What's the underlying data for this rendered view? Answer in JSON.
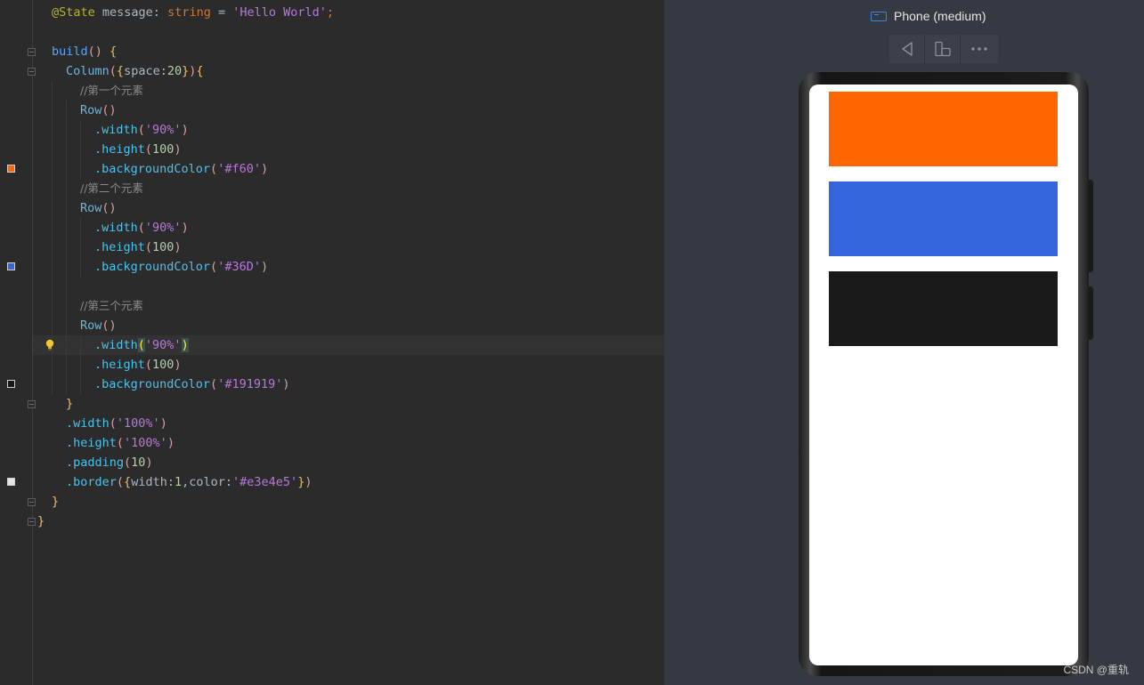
{
  "editor": {
    "lines": [
      [
        [
          "@State",
          "t-anno"
        ],
        [
          " message: ",
          "t-plain"
        ],
        [
          "string",
          "t-kw"
        ],
        [
          " = ",
          "t-plain"
        ],
        [
          "'Hello World'",
          "t-str"
        ],
        [
          ";",
          "t-kw"
        ]
      ],
      [],
      [
        [
          "build",
          "t-fn"
        ],
        [
          "() ",
          "t-paren"
        ],
        [
          "{",
          "t-brace"
        ]
      ],
      [
        [
          "Column",
          "t-comp"
        ],
        [
          "(",
          "t-paren"
        ],
        [
          "{",
          "t-brace"
        ],
        [
          "space",
          "t-prop"
        ],
        [
          ":",
          "t-plain"
        ],
        [
          "20",
          "t-num"
        ],
        [
          "}",
          "t-brace"
        ],
        [
          ")",
          "t-paren"
        ],
        [
          "{",
          "t-brace"
        ]
      ],
      [
        [
          "//第一个元素",
          "t-cmt"
        ]
      ],
      [
        [
          "Row",
          "t-comp"
        ],
        [
          "()",
          "t-paren"
        ]
      ],
      [
        [
          ".width",
          "t-meth"
        ],
        [
          "(",
          "t-paren"
        ],
        [
          "'90%'",
          "t-str"
        ],
        [
          ")",
          "t-paren"
        ]
      ],
      [
        [
          ".height",
          "t-meth"
        ],
        [
          "(",
          "t-paren"
        ],
        [
          "100",
          "t-num"
        ],
        [
          ")",
          "t-paren"
        ]
      ],
      [
        [
          ".backgroundColor",
          "t-meth"
        ],
        [
          "(",
          "t-paren"
        ],
        [
          "'#f60'",
          "t-str"
        ],
        [
          ")",
          "t-paren"
        ]
      ],
      [
        [
          "//第二个元素",
          "t-cmt"
        ]
      ],
      [
        [
          "Row",
          "t-comp"
        ],
        [
          "()",
          "t-paren"
        ]
      ],
      [
        [
          ".width",
          "t-meth"
        ],
        [
          "(",
          "t-paren"
        ],
        [
          "'90%'",
          "t-str"
        ],
        [
          ")",
          "t-paren"
        ]
      ],
      [
        [
          ".height",
          "t-meth"
        ],
        [
          "(",
          "t-paren"
        ],
        [
          "100",
          "t-num"
        ],
        [
          ")",
          "t-paren"
        ]
      ],
      [
        [
          ".backgroundColor",
          "t-meth"
        ],
        [
          "(",
          "t-paren"
        ],
        [
          "'#36D'",
          "t-str"
        ],
        [
          ")",
          "t-paren"
        ]
      ],
      [],
      [
        [
          "//第三个元素",
          "t-cmt"
        ]
      ],
      [
        [
          "Row",
          "t-comp"
        ],
        [
          "()",
          "t-paren"
        ]
      ],
      [
        [
          ".width",
          "t-meth"
        ],
        [
          "(",
          "t-hl"
        ],
        [
          "'90%'",
          "t-str"
        ],
        [
          ")",
          "t-hl"
        ]
      ],
      [
        [
          ".height",
          "t-meth"
        ],
        [
          "(",
          "t-paren"
        ],
        [
          "100",
          "t-num"
        ],
        [
          ")",
          "t-paren"
        ]
      ],
      [
        [
          ".backgroundColor",
          "t-meth"
        ],
        [
          "(",
          "t-paren"
        ],
        [
          "'#191919'",
          "t-str"
        ],
        [
          ")",
          "t-paren"
        ]
      ],
      [
        [
          "}",
          "t-brace"
        ]
      ],
      [
        [
          ".width",
          "t-meth"
        ],
        [
          "(",
          "t-paren"
        ],
        [
          "'100%'",
          "t-str"
        ],
        [
          ")",
          "t-paren"
        ]
      ],
      [
        [
          ".height",
          "t-meth"
        ],
        [
          "(",
          "t-paren"
        ],
        [
          "'100%'",
          "t-str"
        ],
        [
          ")",
          "t-paren"
        ]
      ],
      [
        [
          ".padding",
          "t-meth"
        ],
        [
          "(",
          "t-paren"
        ],
        [
          "10",
          "t-num"
        ],
        [
          ")",
          "t-paren"
        ]
      ],
      [
        [
          ".border",
          "t-meth"
        ],
        [
          "(",
          "t-paren"
        ],
        [
          "{",
          "t-brace"
        ],
        [
          "width",
          "t-prop"
        ],
        [
          ":",
          "t-plain"
        ],
        [
          "1",
          "t-num"
        ],
        [
          ",",
          "t-plain"
        ],
        [
          "color",
          "t-prop"
        ],
        [
          ":",
          "t-plain"
        ],
        [
          "'#e3e4e5'",
          "t-str"
        ],
        [
          "}",
          "t-brace"
        ],
        [
          ")",
          "t-paren"
        ]
      ],
      [
        [
          "}",
          "t-brace"
        ]
      ],
      [
        [
          "}",
          "t-brace"
        ]
      ]
    ],
    "color_swatches": [
      "#ff6600",
      "#3366dd",
      "#191919",
      "#e3e4e5"
    ]
  },
  "preview": {
    "device_title": "Phone (medium)",
    "toolbar": [
      "back-icon",
      "rotate-icon",
      "more-icon"
    ],
    "rows": [
      {
        "color": "#ff6600"
      },
      {
        "color": "#3366dd"
      },
      {
        "color": "#191919"
      }
    ]
  },
  "watermark": "CSDN @重轨"
}
